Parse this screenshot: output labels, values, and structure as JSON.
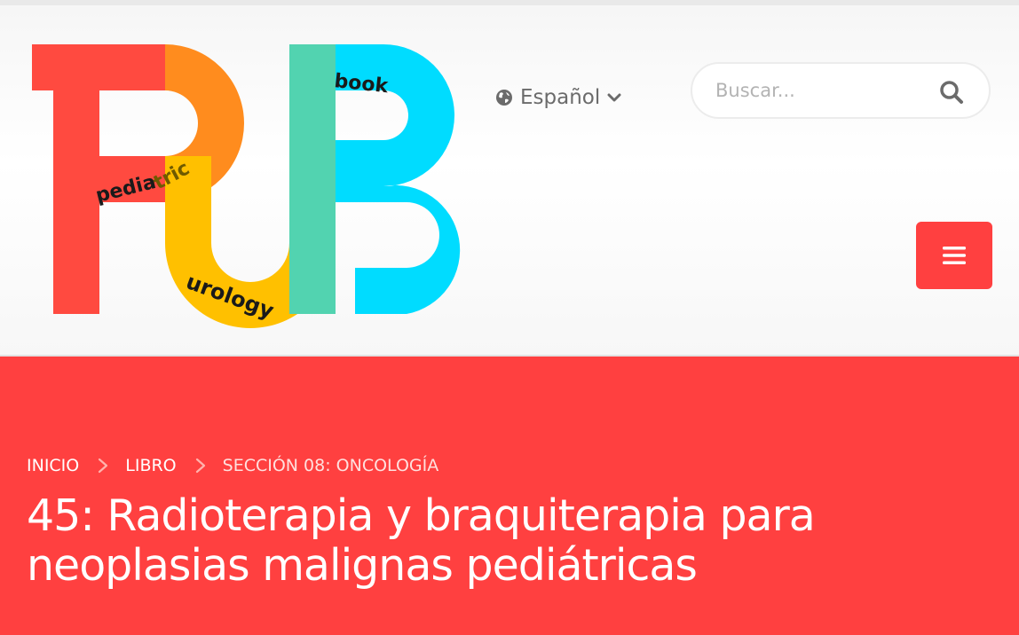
{
  "header": {
    "logo": {
      "words": [
        "pedia",
        "tric",
        "urology",
        "book"
      ],
      "colors": {
        "red": "#ff4a40",
        "orange": "#ff8c1e",
        "yellow": "#ffc000",
        "green": "#52d3b0",
        "cyan": "#00dcff"
      }
    },
    "language": {
      "label": "Español",
      "icon": "globe-icon"
    },
    "search": {
      "placeholder": "Buscar..."
    },
    "menu": {
      "icon": "hamburger-icon"
    }
  },
  "hero": {
    "breadcrumb": [
      {
        "label": "INICIO"
      },
      {
        "label": "LIBRO"
      },
      {
        "label": "SECCIÓN 08: ONCOLOGÍA"
      }
    ],
    "title": "45: Radioterapia y braquiterapia para neoplasias malignas pediátricas",
    "background": "#ff4040"
  }
}
